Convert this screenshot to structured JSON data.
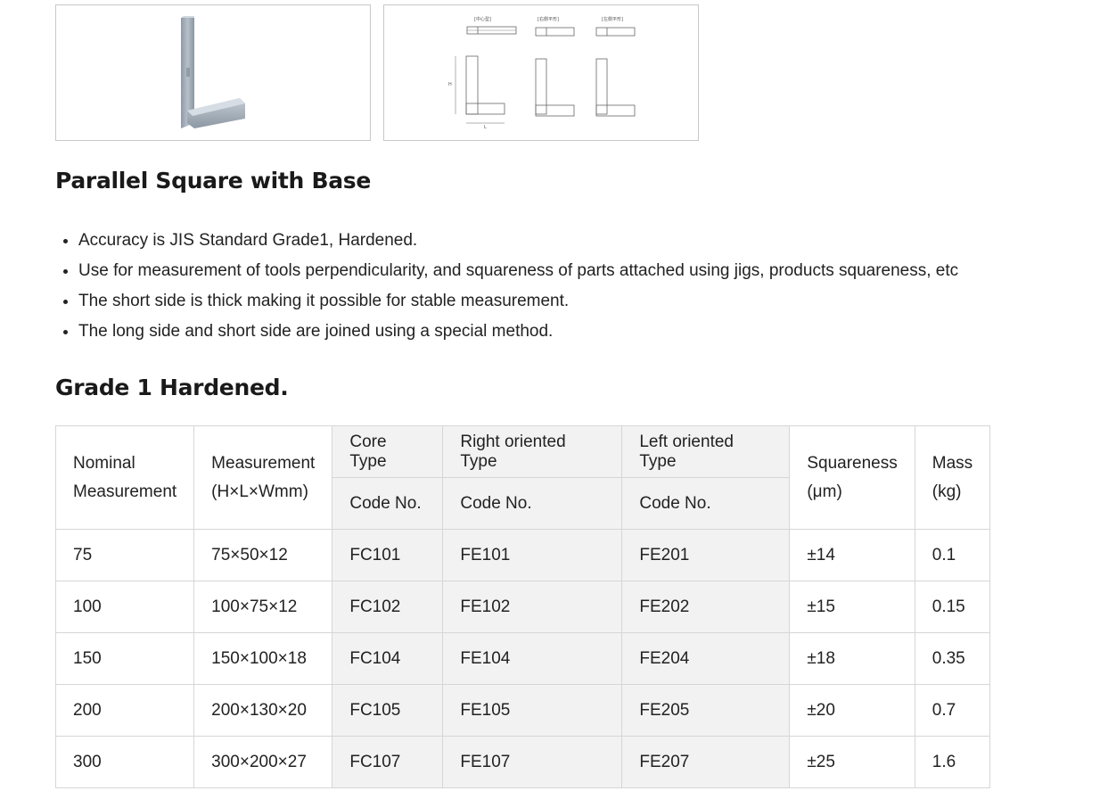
{
  "images": {
    "photo": {
      "alt": "Parallel square photo"
    },
    "drawing": {
      "labels": [
        "[中心型]",
        "[右側平形]",
        "[左側平形]"
      ],
      "dim_h": "H",
      "dim_l": "L"
    }
  },
  "product": {
    "title": "Parallel Square with Base",
    "features": [
      "Accuracy is JIS Standard Grade1, Hardened.",
      "Use for measurement of tools perpendicularity, and squareness of parts attached using jigs, products squareness, etc",
      "The short side is thick making it possible for stable measurement.",
      "The long side and short side are joined using a special method."
    ]
  },
  "grade": {
    "title": "Grade 1 Hardened."
  },
  "table": {
    "headers": {
      "nominal_line1": "Nominal",
      "nominal_line2": "Measurement",
      "measurement_line1": "Measurement",
      "measurement_line2": "(H×L×Wmm)",
      "core_type": "Core Type",
      "right_type": "Right oriented Type",
      "left_type": "Left oriented Type",
      "code_no": "Code No.",
      "squareness_line1": "Squareness",
      "squareness_line2": "(μm)",
      "mass_line1": "Mass",
      "mass_line2": "(kg)"
    },
    "rows": [
      [
        "75",
        "75×50×12",
        "FC101",
        "FE101",
        "FE201",
        "±14",
        "0.1"
      ],
      [
        "100",
        "100×75×12",
        "FC102",
        "FE102",
        "FE202",
        "±15",
        "0.15"
      ],
      [
        "150",
        "150×100×18",
        "FC104",
        "FE104",
        "FE204",
        "±18",
        "0.35"
      ],
      [
        "200",
        "200×130×20",
        "FC105",
        "FE105",
        "FE205",
        "±20",
        "0.7"
      ],
      [
        "300",
        "300×200×27",
        "FC107",
        "FE107",
        "FE207",
        "±25",
        "1.6"
      ]
    ]
  }
}
